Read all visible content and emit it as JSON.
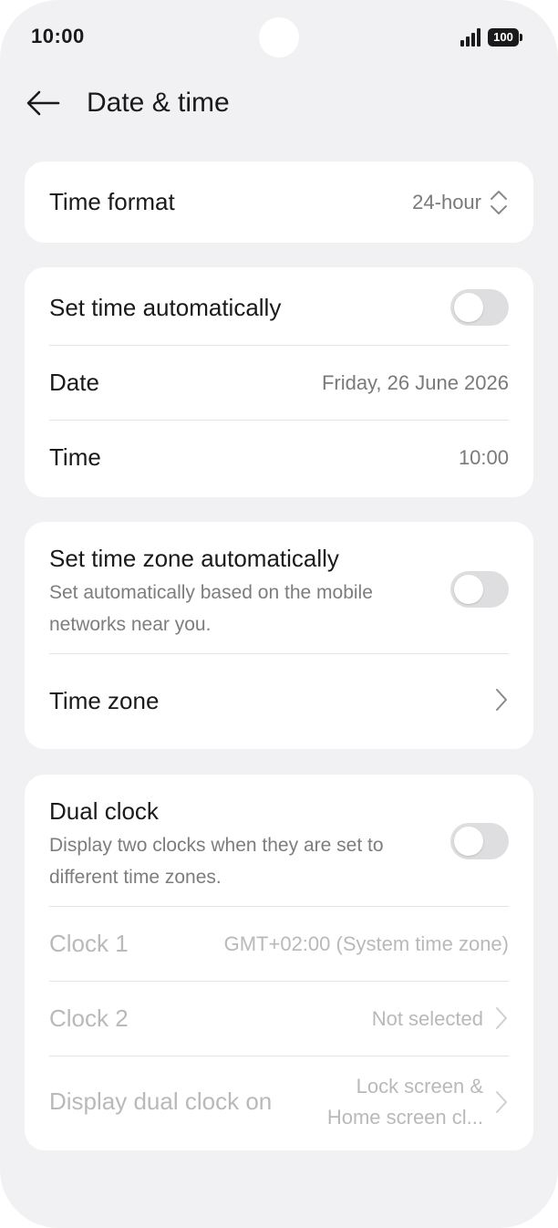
{
  "status_bar": {
    "time": "10:00",
    "battery": "100"
  },
  "header": {
    "title": "Date & time"
  },
  "time_format": {
    "label": "Time format",
    "value": "24-hour"
  },
  "auto_time": {
    "label": "Set time automatically",
    "enabled": false,
    "date_label": "Date",
    "date_value": "Friday, 26 June 2026",
    "time_label": "Time",
    "time_value": "10:00"
  },
  "time_zone": {
    "auto_label": "Set time zone automatically",
    "auto_desc": "Set automatically based on the mobile networks near you.",
    "auto_enabled": false,
    "zone_label": "Time zone"
  },
  "dual_clock": {
    "label": "Dual clock",
    "desc": "Display two clocks when they are set to different time zones.",
    "enabled": false,
    "clock1_label": "Clock 1",
    "clock1_value": "GMT+02:00 (System time zone)",
    "clock2_label": "Clock 2",
    "clock2_value": "Not selected",
    "display_label": "Display dual clock on",
    "display_value_line1": "Lock screen &",
    "display_value_line2": "Home screen cl..."
  },
  "colors": {
    "background": "#f1f1f3",
    "card": "#ffffff",
    "toggle_off": "#dedee0",
    "disabled_text": "#b9b9bb"
  }
}
